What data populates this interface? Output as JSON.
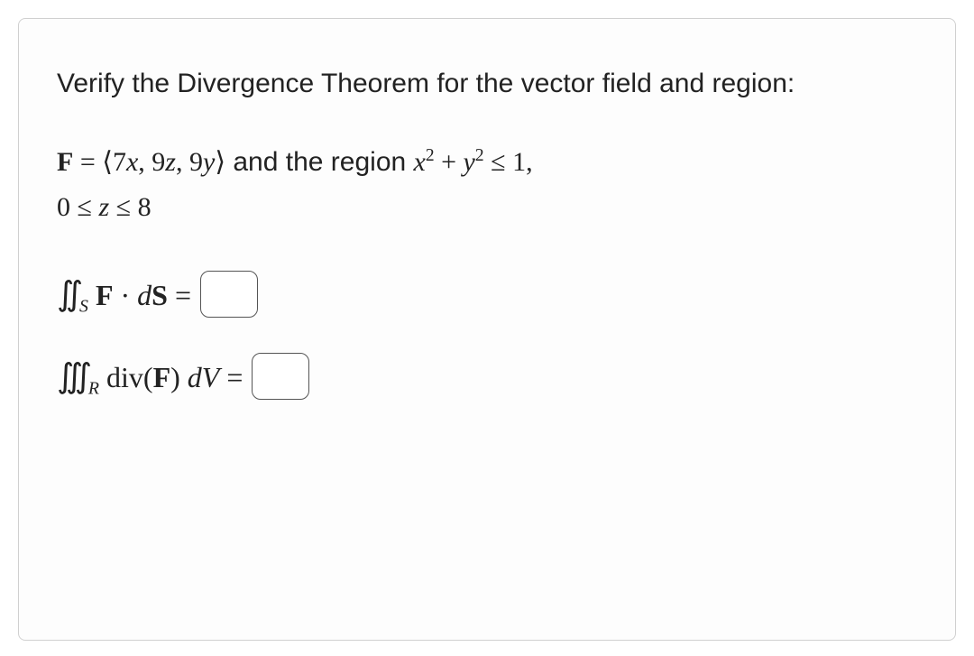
{
  "intro": "Verify the Divergence Theorem for the vector field and region:",
  "vector": {
    "lhs": "F",
    "eq": " = ",
    "open": "⟨",
    "c1": "7",
    "v1": "x",
    "sep1": ", ",
    "c2": "9",
    "v2": "z",
    "sep2": ", ",
    "c3": "9",
    "v3": "y",
    "close": "⟩",
    "region_label": " and the region ",
    "rx": "x",
    "exp1": "2",
    "plus": " + ",
    "ry": "y",
    "exp2": "2",
    "leq1": " ≤ 1,",
    "zlow": "0 ≤ ",
    "zvar": "z",
    "zhigh": " ≤ 8"
  },
  "surface_integral": {
    "int": "∬",
    "sub": "S",
    "F": "F",
    "dot": " · ",
    "d": "d",
    "S": "S",
    "eq": " = "
  },
  "volume_integral": {
    "int": "∭",
    "sub": "R",
    "div": " div",
    "open": "(",
    "F": "F",
    "close": ") ",
    "d": "d",
    "V": "V",
    "eq": " = "
  }
}
